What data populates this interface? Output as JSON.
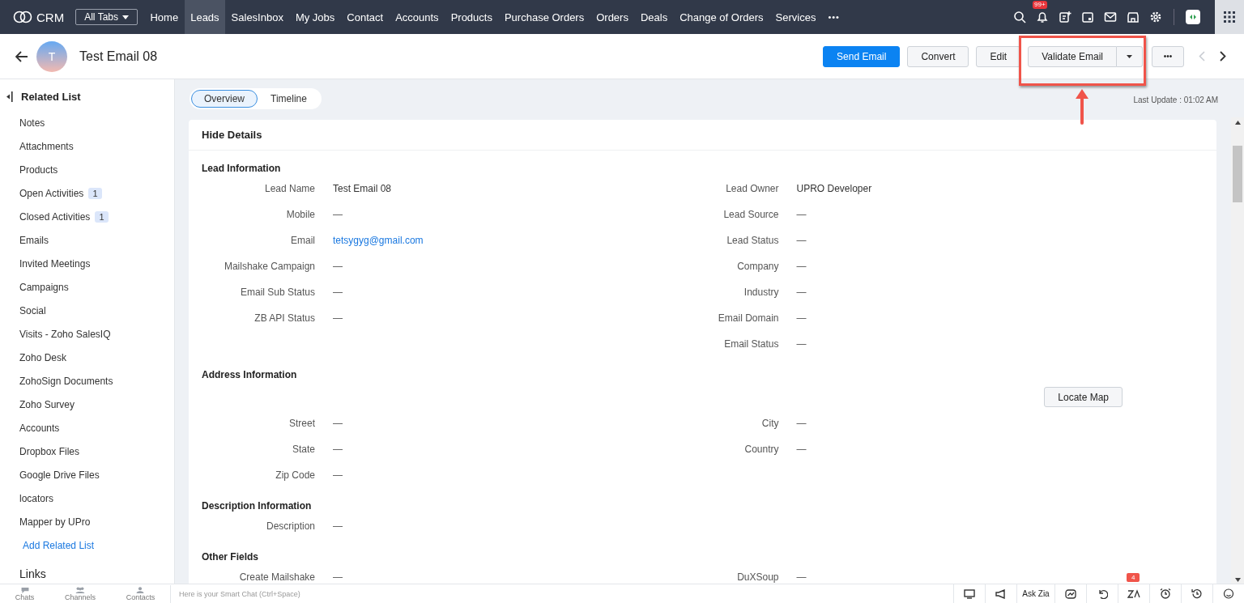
{
  "nav": {
    "logo": "CRM",
    "all_tabs": "All Tabs",
    "more": "•••",
    "notifications": "99+",
    "tabs": [
      {
        "label": "Home",
        "selected": false
      },
      {
        "label": "Leads",
        "selected": true
      },
      {
        "label": "SalesInbox",
        "selected": false
      },
      {
        "label": "My Jobs",
        "selected": false
      },
      {
        "label": "Contact",
        "selected": false
      },
      {
        "label": "Accounts",
        "selected": false
      },
      {
        "label": "Products",
        "selected": false
      },
      {
        "label": "Purchase Orders",
        "selected": false
      },
      {
        "label": "Orders",
        "selected": false
      },
      {
        "label": "Deals",
        "selected": false
      },
      {
        "label": "Change of Orders",
        "selected": false
      },
      {
        "label": "Services",
        "selected": false
      }
    ]
  },
  "header": {
    "avatar": "T",
    "title": "Test Email 08",
    "more": "•••",
    "buttons": [
      {
        "label": "Send Email",
        "kind": "primary"
      },
      {
        "label": "Convert",
        "kind": "default"
      },
      {
        "label": "Edit",
        "kind": "default"
      },
      {
        "label": "Validate Email",
        "kind": "split"
      }
    ]
  },
  "sidebar": {
    "heading": "Related List",
    "add": "Add Related List",
    "links_heading": "Links",
    "items": [
      {
        "label": "Notes"
      },
      {
        "label": "Attachments"
      },
      {
        "label": "Products"
      },
      {
        "label": "Open Activities",
        "badge": "1"
      },
      {
        "label": "Closed Activities",
        "badge": "1"
      },
      {
        "label": "Emails"
      },
      {
        "label": "Invited Meetings"
      },
      {
        "label": "Campaigns"
      },
      {
        "label": "Social"
      },
      {
        "label": "Visits - Zoho SalesIQ"
      },
      {
        "label": "Zoho Desk"
      },
      {
        "label": "ZohoSign Documents"
      },
      {
        "label": "Zoho Survey"
      },
      {
        "label": "Accounts"
      },
      {
        "label": "Dropbox Files"
      },
      {
        "label": "Google Drive Files"
      },
      {
        "label": "locators"
      },
      {
        "label": "Mapper by UPro"
      }
    ]
  },
  "view_tabs": [
    {
      "label": "Overview",
      "selected": true
    },
    {
      "label": "Timeline",
      "selected": false
    }
  ],
  "last_update": "Last Update : 01:02 AM",
  "details": {
    "toggle": "Hide Details",
    "sections": [
      {
        "title": "Lead Information",
        "rows": [
          {
            "left": {
              "label": "Lead Name",
              "value": "Test Email 08",
              "kind": "text"
            },
            "right": {
              "label": "Lead Owner",
              "value": "UPRO Developer",
              "kind": "text"
            }
          },
          {
            "left": {
              "label": "Mobile",
              "value": "—",
              "kind": "empty"
            },
            "right": {
              "label": "Lead Source",
              "value": "—",
              "kind": "empty"
            }
          },
          {
            "left": {
              "label": "Email",
              "value": "tetsygyg@gmail.com",
              "kind": "link"
            },
            "right": {
              "label": "Lead Status",
              "value": "—",
              "kind": "empty"
            }
          },
          {
            "left": {
              "label": "Mailshake Campaign",
              "value": "—",
              "kind": "empty"
            },
            "right": {
              "label": "Company",
              "value": "—",
              "kind": "empty"
            }
          },
          {
            "left": {
              "label": "Email Sub Status",
              "value": "—",
              "kind": "empty"
            },
            "right": {
              "label": "Industry",
              "value": "—",
              "kind": "empty"
            }
          },
          {
            "left": {
              "label": "ZB API Status",
              "value": "—",
              "kind": "empty"
            },
            "right": {
              "label": "Email Domain",
              "value": "—",
              "kind": "empty"
            }
          },
          {
            "left": null,
            "right": {
              "label": "Email Status",
              "value": "—",
              "kind": "empty"
            }
          }
        ]
      },
      {
        "title": "Address Information",
        "action": "Locate Map",
        "rows": [
          {
            "left": {
              "label": "Street",
              "value": "—",
              "kind": "empty"
            },
            "right": {
              "label": "City",
              "value": "—",
              "kind": "empty"
            }
          },
          {
            "left": {
              "label": "State",
              "value": "—",
              "kind": "empty"
            },
            "right": {
              "label": "Country",
              "value": "—",
              "kind": "empty"
            }
          },
          {
            "left": {
              "label": "Zip Code",
              "value": "—",
              "kind": "empty"
            },
            "right": null
          }
        ]
      },
      {
        "title": "Description Information",
        "rows": [
          {
            "left": {
              "label": "Description",
              "value": "—",
              "kind": "empty"
            },
            "right": null
          }
        ]
      },
      {
        "title": "Other Fields",
        "rows": [
          {
            "left": {
              "label": "Create Mailshake",
              "value": "—",
              "kind": "empty"
            },
            "right": {
              "label": "DuXSoup",
              "value": "—",
              "kind": "empty"
            }
          }
        ]
      }
    ]
  },
  "footer": {
    "apps": [
      {
        "label": "Chats",
        "kind": "chat"
      },
      {
        "label": "Channels",
        "kind": "people"
      },
      {
        "label": "Contacts",
        "kind": "person"
      }
    ],
    "chat_placeholder": "Here is your Smart Chat (Ctrl+Space)",
    "ask_zia": "Ask Zia",
    "zia_badge": "4"
  }
}
